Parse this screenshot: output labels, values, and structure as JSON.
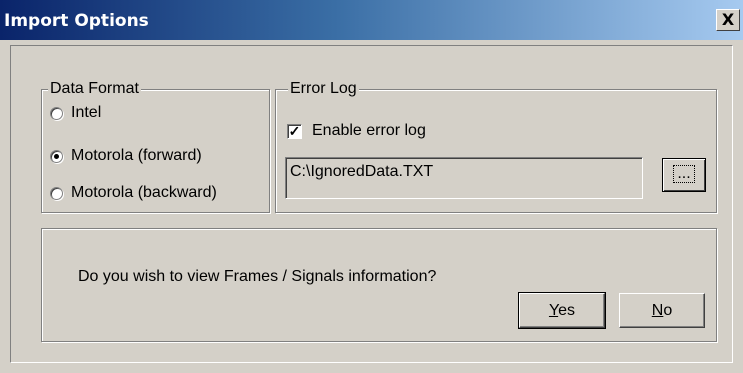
{
  "window": {
    "title": "Import Options",
    "close_label": "X"
  },
  "data_format": {
    "legend": "Data Format",
    "options": [
      {
        "label": "Intel",
        "checked": false
      },
      {
        "label": "Motorola (forward)",
        "checked": true
      },
      {
        "label": "Motorola (backward)",
        "checked": false
      }
    ]
  },
  "error_log": {
    "legend": "Error Log",
    "enable_label": "Enable error log",
    "enabled": true,
    "check_mark": "✓",
    "path_value": "C:\\IgnoredData.TXT",
    "browse_label": "..."
  },
  "prompt": {
    "question": "Do you wish to view Frames / Signals information?",
    "yes_mnemonic": "Y",
    "yes_rest": "es",
    "no_mnemonic": "N",
    "no_rest": "o"
  }
}
